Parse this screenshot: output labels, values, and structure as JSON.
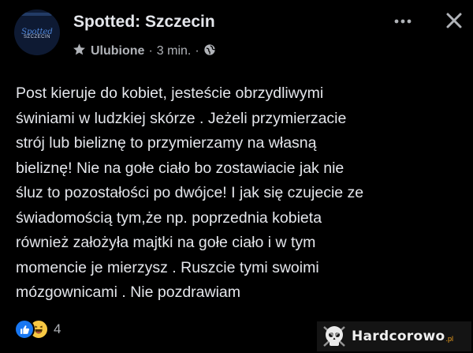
{
  "header": {
    "page_name": "Spotted: Szczecin",
    "avatar_text_1": "Spotted",
    "avatar_text_2": "SZCZECIN",
    "favorite_label": "Ulubione",
    "time": "3 min.",
    "separator": "·"
  },
  "post": {
    "text": "Post kieruje do kobiet, jesteście obrzydliwymi\nświniami w ludzkiej skórze . Jeżeli przymierzacie\nstrój lub bieliznę to przymierzamy na własną\nbieliznę! Nie na gołe ciało bo zostawiacie jak nie\nśluz to pozostałości po dwójce! I jak się czujecie ze\nświadomością tym,że np. poprzednia kobieta\nrównież założyła majtki na gołe ciało i w tym\nmomencie je mierzysz . Ruszcie tymi swoimi\nmózgownicami . Nie pozdrawiam"
  },
  "reactions": {
    "count": "4",
    "types": [
      "like",
      "haha"
    ]
  },
  "watermark": {
    "brand": "Hardcorowo",
    "suffix": ".pl"
  },
  "icons": {
    "more": "more-options-icon",
    "close": "close-icon",
    "star": "star-icon",
    "globe": "globe-icon"
  },
  "colors": {
    "background": "#000000",
    "text": "#e4e6eb",
    "secondary_text": "#b0b3b8",
    "like_blue": "#1877f2",
    "haha_yellow": "#f7c843"
  }
}
